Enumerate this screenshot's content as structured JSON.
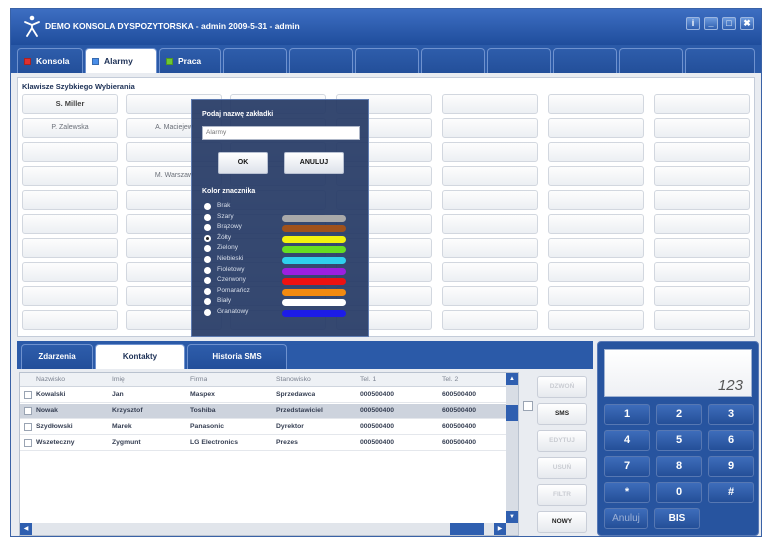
{
  "window": {
    "title": "DEMO KONSOLA DYSPOZYTORSKA - admin 2009-5-31 - admin",
    "controls": [
      "i",
      "_",
      "□",
      "✖"
    ]
  },
  "top_tabs": [
    {
      "label": "Konsola",
      "color": "#e03030"
    },
    {
      "label": "Alarmy",
      "color": "#4a8ee8"
    },
    {
      "label": "Praca",
      "color": "#6cc832"
    }
  ],
  "speed_dial": {
    "header": "Klawisze Szybkiego Wybierania",
    "buttons": [
      "S. Miller",
      "P. Zalewska",
      "A. Maciejew",
      "M. Warszaw"
    ]
  },
  "dialog": {
    "prompt": "Podaj nazwę zakładki",
    "input_value": "Alarmy",
    "ok_label": "OK",
    "cancel_label": "ANULUJ",
    "color_label": "Kolor znacznika",
    "colors": [
      {
        "name": "Brak",
        "hex": "",
        "selected": false
      },
      {
        "name": "Szary",
        "hex": "#a9a9a9",
        "selected": false
      },
      {
        "name": "Brązowy",
        "hex": "#a0521c",
        "selected": false
      },
      {
        "name": "Żółty",
        "hex": "#f2f20f",
        "selected": true
      },
      {
        "name": "Zielony",
        "hex": "#66dd22",
        "selected": false
      },
      {
        "name": "Niebieski",
        "hex": "#2ed0ee",
        "selected": false
      },
      {
        "name": "Fioletowy",
        "hex": "#9b1fe0",
        "selected": false
      },
      {
        "name": "Czerwony",
        "hex": "#ee1111",
        "selected": false
      },
      {
        "name": "Pomarańcz",
        "hex": "#f28a10",
        "selected": false
      },
      {
        "name": "Biały",
        "hex": "#ffffff",
        "selected": false
      },
      {
        "name": "Granatowy",
        "hex": "#1c1ce8",
        "selected": false
      }
    ]
  },
  "bottom_tabs": [
    "Zdarzenia",
    "Kontakty",
    "Historia SMS"
  ],
  "contacts": {
    "columns": [
      "Nazwisko",
      "Imię",
      "Firma",
      "Stanowisko",
      "Tel. 1",
      "Tel. 2"
    ],
    "rows": [
      [
        "Kowalski",
        "Jan",
        "Maspex",
        "Sprzedawca",
        "000500400",
        "600500400"
      ],
      [
        "Nowak",
        "Krzysztof",
        "Toshiba",
        "Przedstawiciel",
        "000500400",
        "600500400"
      ],
      [
        "Szydłowski",
        "Marek",
        "Panasonic",
        "Dyrektor",
        "000500400",
        "600500400"
      ],
      [
        "Wszeteczny",
        "Zygmunt",
        "LG Electronics",
        "Prezes",
        "000500400",
        "600500400"
      ]
    ],
    "selected_row": 1
  },
  "actions": [
    "DZWOŃ",
    "SMS",
    "EDYTUJ",
    "USUŃ",
    "FILTR",
    "NOWY"
  ],
  "dialpad": {
    "display": "123",
    "keys": [
      "1",
      "2",
      "3",
      "4",
      "5",
      "6",
      "7",
      "8",
      "9",
      "*",
      "0",
      "#"
    ],
    "cancel_label": "Anuluj",
    "redial_label": "BIS"
  }
}
